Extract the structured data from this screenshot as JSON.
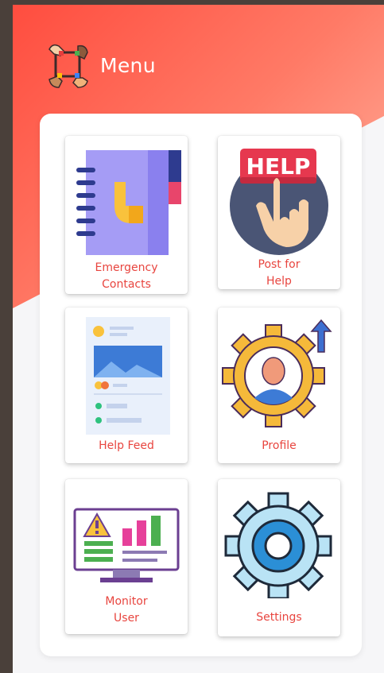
{
  "header": {
    "title": "Menu",
    "logo_icon": "hands-circle-icon"
  },
  "colors": {
    "accent": "#ff4d3f",
    "label": "#e8453f"
  },
  "tiles": [
    {
      "label_line1": "Emergency",
      "label_line2": "Contacts",
      "icon": "contact-book-icon"
    },
    {
      "label_line1": "Post for",
      "label_line2": "Help",
      "icon": "help-button-icon",
      "icon_text": "HELP"
    },
    {
      "label_line1": "Help Feed",
      "icon": "feed-icon"
    },
    {
      "label_line1": "Profile",
      "icon": "profile-gear-icon"
    },
    {
      "label_line1": "Monitor",
      "label_line2": "User",
      "icon": "monitor-dashboard-icon"
    },
    {
      "label_line1": "Settings",
      "icon": "settings-gear-icon"
    }
  ]
}
